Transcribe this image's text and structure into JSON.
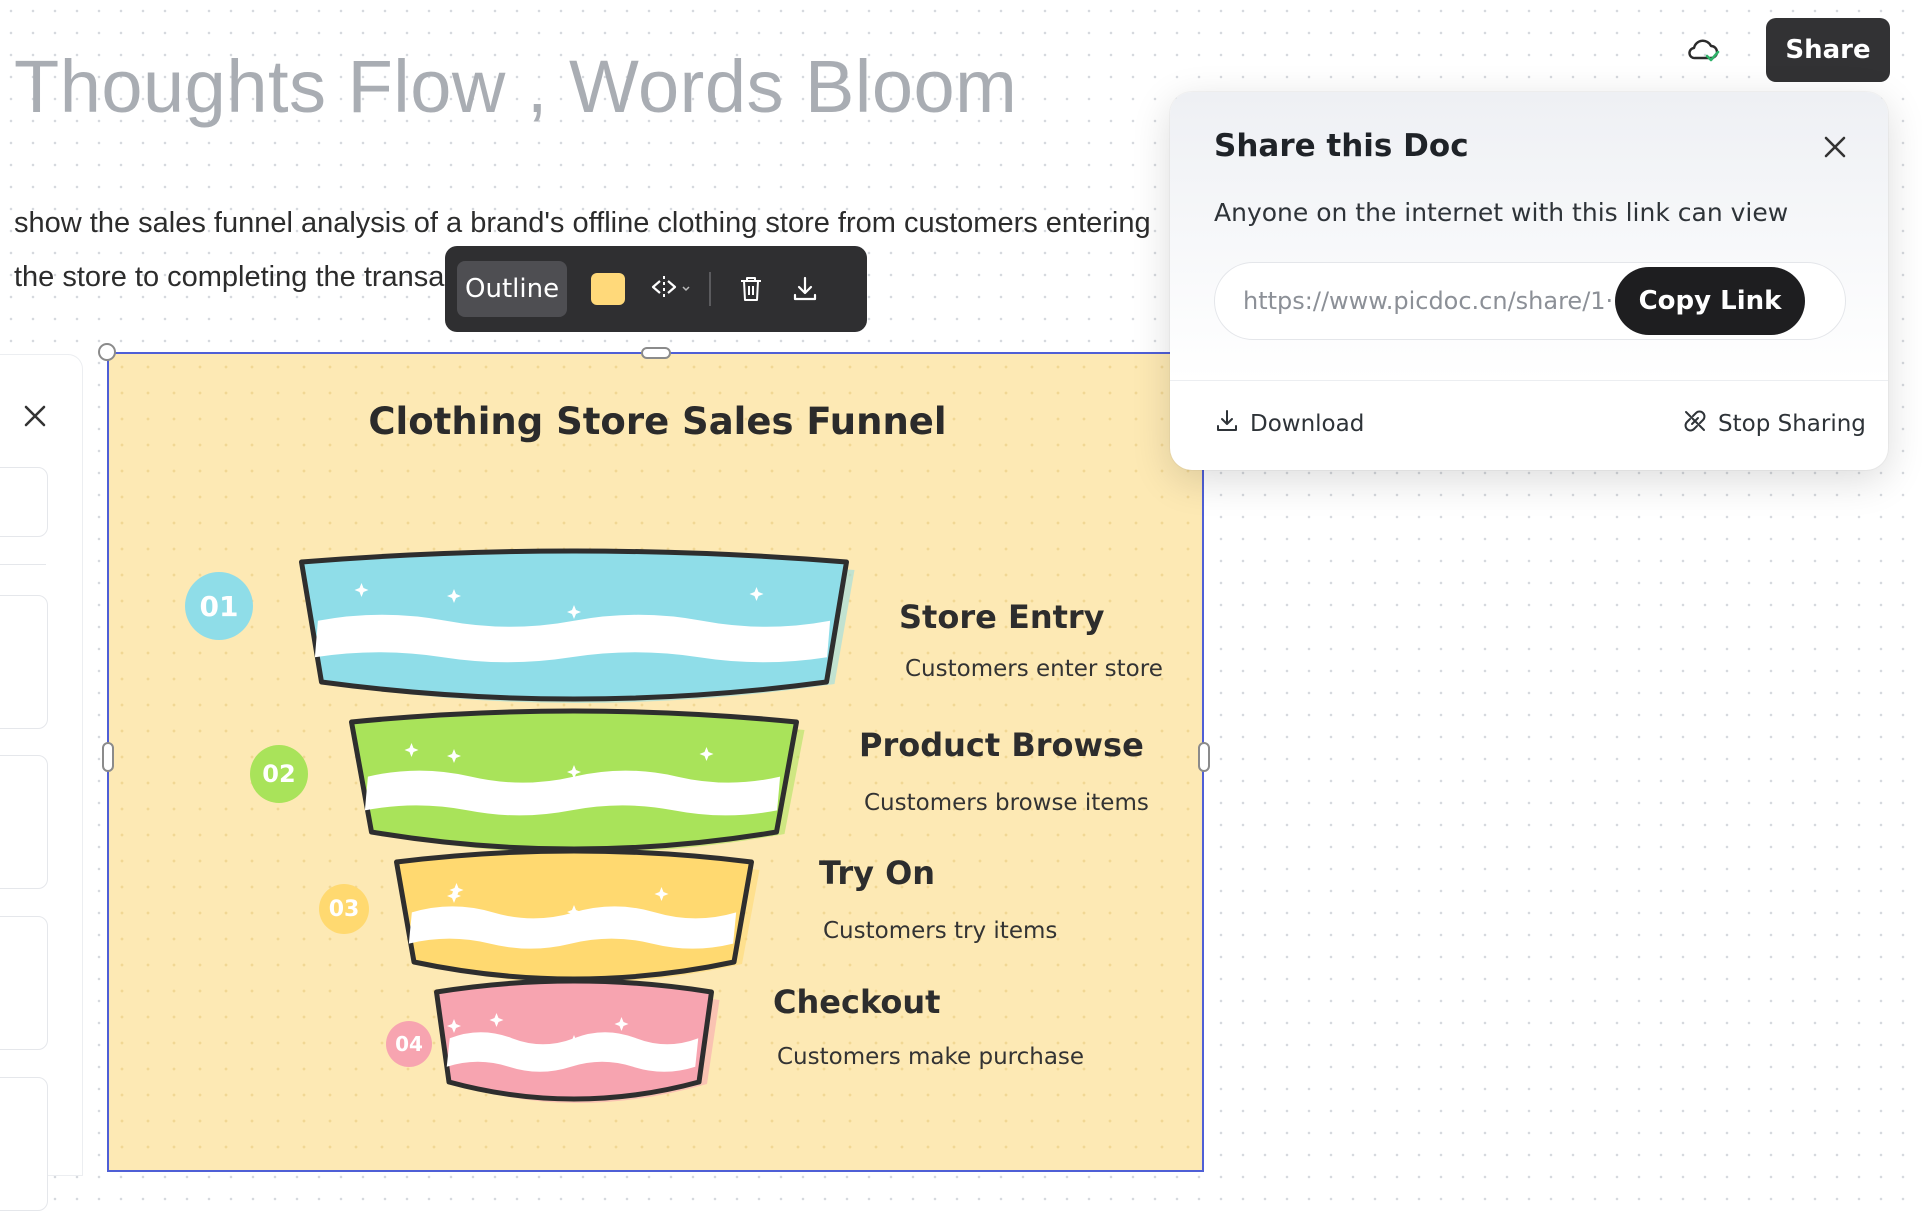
{
  "document": {
    "title": "Thoughts Flow , Words Bloom",
    "prompt_text": "show the sales funnel analysis of a brand's offline clothing store from customers entering the store to completing the transaction"
  },
  "header": {
    "cloud_status_icon": "cloud-synced-icon",
    "share_label": "Share"
  },
  "toolbar": {
    "outline_label": "Outline",
    "color_swatch": "#ffd97a",
    "icons": [
      "flip-icon",
      "chevron-down-icon",
      "trash-icon",
      "download-icon"
    ]
  },
  "share_popover": {
    "title": "Share this Doc",
    "subtitle": "Anyone on the internet with this link can view",
    "link": "https://www.picdoc.cn/share/1···",
    "copy_label": "Copy Link",
    "download_label": "Download",
    "stop_label": "Stop Sharing"
  },
  "chart_data": {
    "type": "funnel",
    "title": "Clothing Store Sales Funnel",
    "stages": [
      {
        "num": "01",
        "name": "Store Entry",
        "desc": "Customers enter store",
        "color": "#8fdde8"
      },
      {
        "num": "02",
        "name": "Product Browse",
        "desc": "Customers browse items",
        "color": "#a9e35a"
      },
      {
        "num": "03",
        "name": "Try On",
        "desc": "Customers try items",
        "color": "#ffd970"
      },
      {
        "num": "04",
        "name": "Checkout",
        "desc": "Customers make purchase",
        "color": "#f7a4b0"
      }
    ]
  },
  "colors": {
    "frame_background": "#fde9b4",
    "selection_border": "#4f5fd6",
    "toolbar_bg": "#2f2f31"
  }
}
